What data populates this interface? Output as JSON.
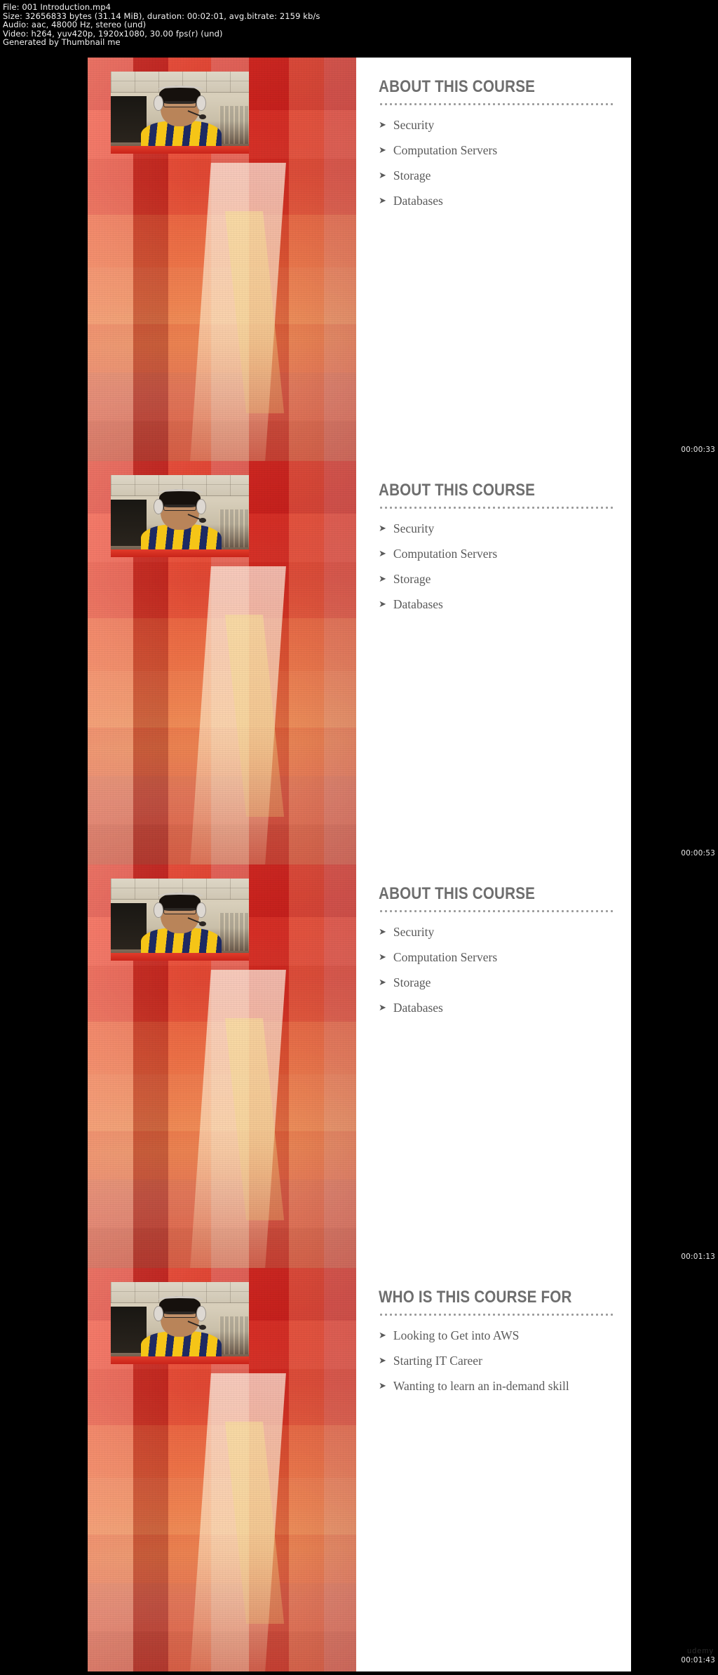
{
  "meta": {
    "line1": "File: 001 Introduction.mp4",
    "line2": "Size: 32656833 bytes (31.14 MiB), duration: 00:02:01, avg.bitrate: 2159 kb/s",
    "line3": "Audio: aac, 48000 Hz, stereo (und)",
    "line4": "Video: h264, yuv420p, 1920x1080, 30.00 fps(r) (und)",
    "line5": "Generated by Thumbnail me"
  },
  "colors": {
    "background": "#000000",
    "slide_panel": "#ffffff",
    "heading_text": "#6e6e6e",
    "body_text": "#5a5a5a",
    "dots": "#9a9a9a",
    "art_primary": "#d5241f",
    "art_accent": "#ff9850"
  },
  "watermark": "udemy",
  "frames": [
    {
      "timestamp": "00:00:33",
      "heading": "ABOUT THIS COURSE",
      "bullets": [
        "Security",
        "Computation Servers",
        "Storage",
        "Databases"
      ],
      "bullet_marker": "➤"
    },
    {
      "timestamp": "00:00:53",
      "heading": "ABOUT THIS COURSE",
      "bullets": [
        "Security",
        "Computation Servers",
        "Storage",
        "Databases"
      ],
      "bullet_marker": "➤"
    },
    {
      "timestamp": "00:01:13",
      "heading": "ABOUT THIS COURSE",
      "bullets": [
        "Security",
        "Computation Servers",
        "Storage",
        "Databases"
      ],
      "bullet_marker": "➤"
    },
    {
      "timestamp": "00:01:43",
      "heading": "WHO IS THIS COURSE FOR",
      "bullets": [
        "Looking to Get into AWS",
        "Starting IT Career",
        "Wanting to learn an in-demand skill"
      ],
      "bullet_marker": "➤"
    }
  ]
}
